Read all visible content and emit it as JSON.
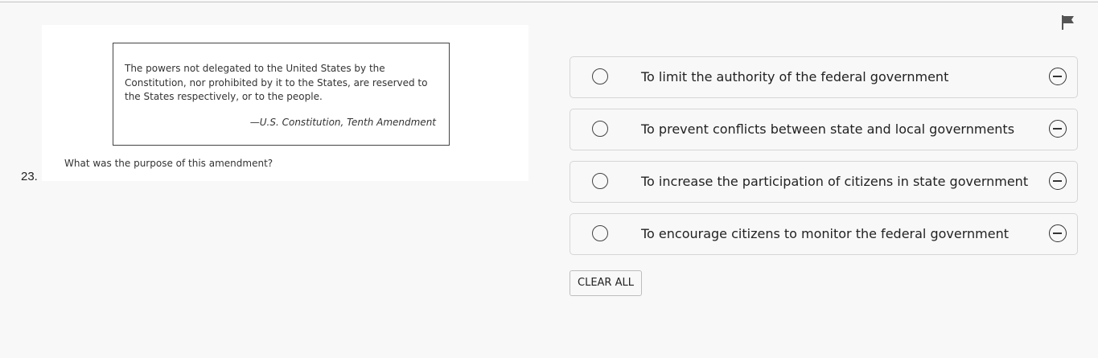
{
  "question": {
    "number": "23.",
    "quote": "The powers not delegated to the United States by the Constitution, nor prohibited by it to the States, are reserved to the States respectively, or to the people.",
    "quote_source": "—U.S. Constitution, Tenth Amendment",
    "stem": "What was the purpose of this amendment?"
  },
  "choices": [
    {
      "label": "To limit the authority of the federal government"
    },
    {
      "label": "To prevent conflicts between state and local governments"
    },
    {
      "label": "To increase the participation of citizens in state government"
    },
    {
      "label": "To encourage citizens to monitor the federal government"
    }
  ],
  "clear_all_label": "CLEAR ALL",
  "icons": {
    "flag": "flag-icon",
    "radio": "radio-unselected-icon",
    "eliminate": "eliminate-choice-icon"
  }
}
